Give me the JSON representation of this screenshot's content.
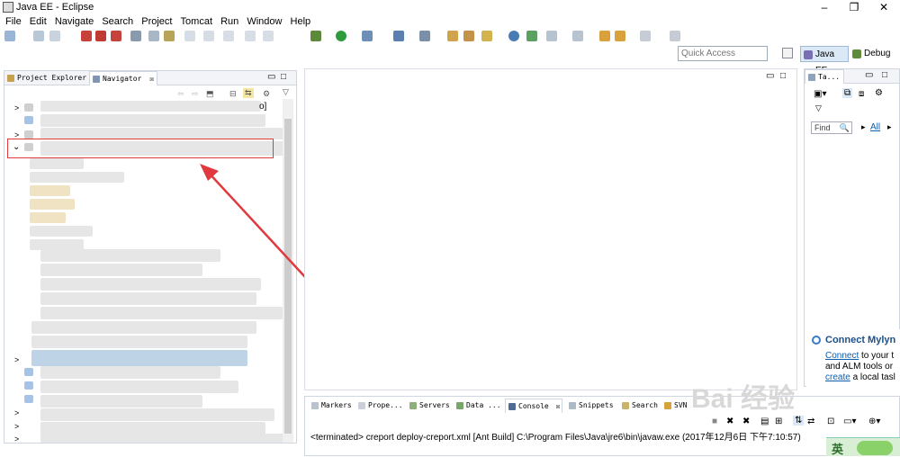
{
  "window": {
    "title": "Java EE - Eclipse",
    "minimize": "–",
    "maximize": "❐",
    "close": "✕"
  },
  "menu": [
    "File",
    "Edit",
    "Navigate",
    "Search",
    "Project",
    "Tomcat",
    "Run",
    "Window",
    "Help"
  ],
  "quick_access": {
    "placeholder": "Quick Access"
  },
  "perspectives": [
    {
      "label": "Java EE",
      "active": true
    },
    {
      "label": "Debug",
      "active": false
    }
  ],
  "left_panel": {
    "tabs": [
      {
        "label": "Project Explorer",
        "active": false
      },
      {
        "label": "Navigator",
        "active": true,
        "close": "☒"
      }
    ],
    "partial_text": "o]"
  },
  "right_panel": {
    "tab": "Ta...",
    "find_placeholder": "Find",
    "all_label": "All",
    "mylyn": {
      "title": "Connect Mylyn",
      "line1_link": "Connect",
      "line1_rest": " to your t",
      "line2": "and ALM tools or",
      "line3_link": "create",
      "line3_rest": " a local tasl"
    }
  },
  "bottom_panel": {
    "tabs": [
      {
        "label": "Markers",
        "active": false
      },
      {
        "label": "Prope...",
        "active": false
      },
      {
        "label": "Servers",
        "active": false
      },
      {
        "label": "Data ...",
        "active": false
      },
      {
        "label": "Console",
        "active": true,
        "close": "☒"
      },
      {
        "label": "Snippets",
        "active": false
      },
      {
        "label": "Search",
        "active": false
      },
      {
        "label": "SVN",
        "active": false
      }
    ],
    "console_output": "<terminated> creport deploy-creport.xml [Ant Build] C:\\Program Files\\Java\\jre6\\bin\\javaw.exe (2017年12月6日 下午7:10:57)"
  },
  "ime": {
    "label": "英"
  },
  "watermark": "Bai 经验",
  "colors": {
    "highlight_box": "#e0393e",
    "arrow": "#e0393e",
    "link": "#0b5cad",
    "mylyn_title": "#1d4f8a"
  }
}
